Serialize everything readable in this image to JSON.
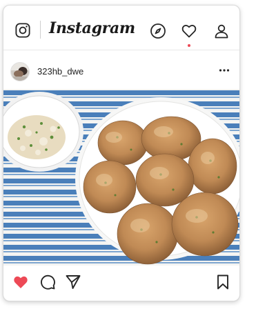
{
  "app": {
    "name": "Instagram"
  },
  "post": {
    "username": "323hb_dwe",
    "liked": true
  },
  "icons": {
    "camera": "instagram-camera-icon",
    "explore": "compass-icon",
    "activity": "heart-outline-icon",
    "profile": "person-icon",
    "more": "more-horizontal-icon",
    "like": "heart-filled-icon",
    "comment": "comment-bubble-icon",
    "share": "paper-plane-icon",
    "save": "bookmark-icon"
  },
  "colors": {
    "like_red": "#ed4956",
    "icon_dark": "#262626",
    "notification_dot": "#ed4956"
  }
}
